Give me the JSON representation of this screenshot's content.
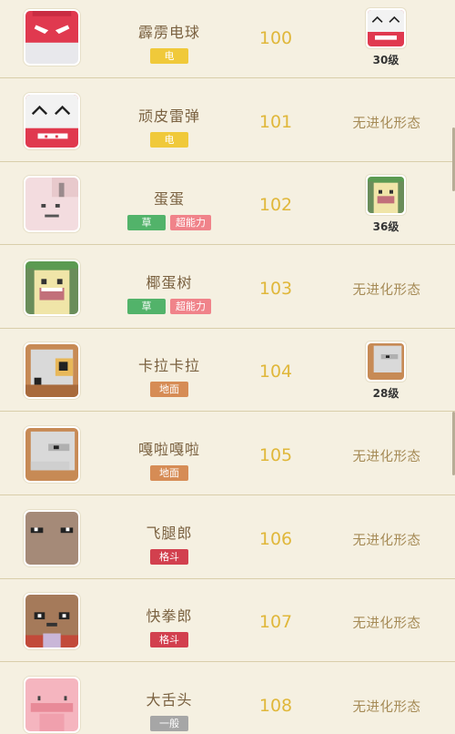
{
  "colors": {
    "background": "#f5f0e1",
    "divider": "#d9ceaa",
    "number": "#e0b73a",
    "name": "#7a6140",
    "no_evolution": "#a58a55"
  },
  "type_colors": {
    "电": "#f0c93a",
    "草": "#52b36a",
    "超能力": "#f0838a",
    "地面": "#d68c55",
    "格斗": "#d2404e",
    "一般": "#a6a6a6"
  },
  "pokemon": [
    {
      "name": "霹雳电球",
      "number": "100",
      "types": [
        "电"
      ],
      "sprite_icon": "electrode-icon",
      "evolution": {
        "has": true,
        "level": "30级",
        "sprite_icon": "electrode-evo-icon"
      }
    },
    {
      "name": "顽皮雷弹",
      "number": "101",
      "types": [
        "电"
      ],
      "sprite_icon": "electrode-alt-icon",
      "evolution": {
        "has": false,
        "text": "无进化形态"
      }
    },
    {
      "name": "蛋蛋",
      "number": "102",
      "types": [
        "草",
        "超能力"
      ],
      "sprite_icon": "exeggcute-icon",
      "evolution": {
        "has": true,
        "level": "36级",
        "sprite_icon": "exeggutor-evo-icon"
      }
    },
    {
      "name": "椰蛋树",
      "number": "103",
      "types": [
        "草",
        "超能力"
      ],
      "sprite_icon": "exeggutor-icon",
      "evolution": {
        "has": false,
        "text": "无进化形态"
      }
    },
    {
      "name": "卡拉卡拉",
      "number": "104",
      "types": [
        "地面"
      ],
      "sprite_icon": "cubone-icon",
      "evolution": {
        "has": true,
        "level": "28级",
        "sprite_icon": "marowak-evo-icon"
      }
    },
    {
      "name": "嘎啦嘎啦",
      "number": "105",
      "types": [
        "地面"
      ],
      "sprite_icon": "marowak-icon",
      "evolution": {
        "has": false,
        "text": "无进化形态"
      }
    },
    {
      "name": "飞腿郎",
      "number": "106",
      "types": [
        "格斗"
      ],
      "sprite_icon": "hitmonlee-icon",
      "evolution": {
        "has": false,
        "text": "无进化形态"
      }
    },
    {
      "name": "快拳郎",
      "number": "107",
      "types": [
        "格斗"
      ],
      "sprite_icon": "hitmonchan-icon",
      "evolution": {
        "has": false,
        "text": "无进化形态"
      }
    },
    {
      "name": "大舌头",
      "number": "108",
      "types": [
        "一般"
      ],
      "sprite_icon": "lickitung-icon",
      "evolution": {
        "has": false,
        "text": "无进化形态"
      }
    }
  ]
}
